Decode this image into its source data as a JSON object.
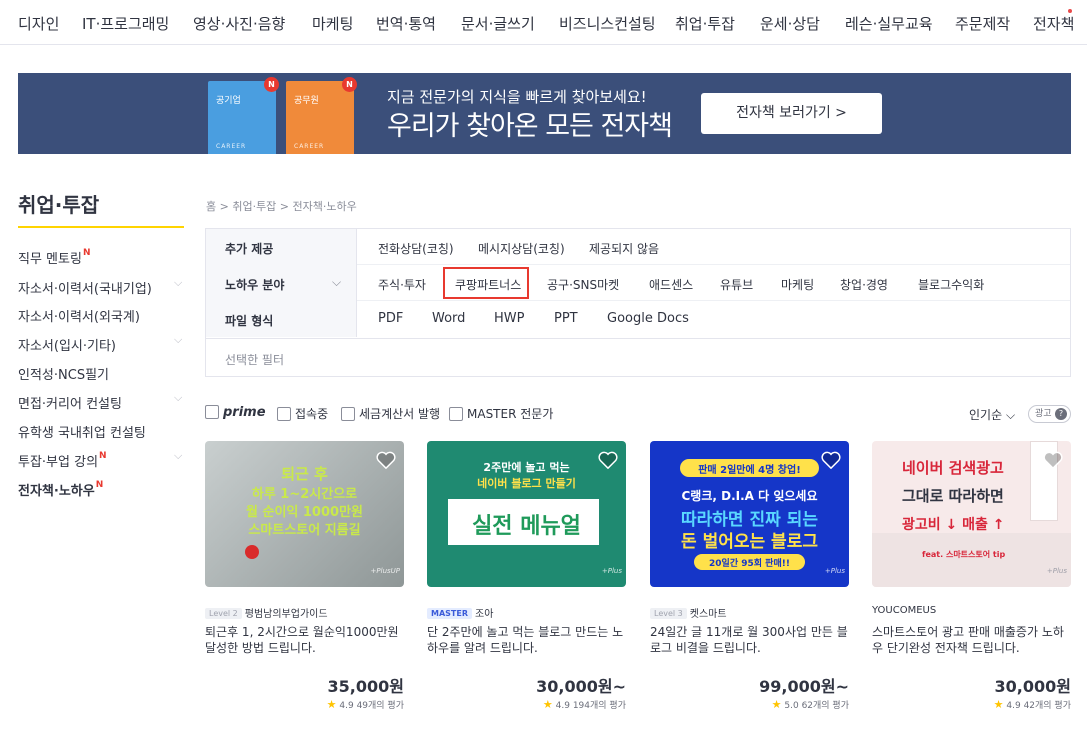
{
  "topnav": [
    "디자인",
    "IT·프로그래밍",
    "영상·사진·음향",
    "마케팅",
    "번역·통역",
    "문서·글쓰기",
    "비즈니스컨설팅",
    "취업·투잡",
    "운세·상담",
    "레슨·실무교육",
    "주문제작",
    "전자책"
  ],
  "banner": {
    "book1_title": "공기업",
    "book2_title": "공무원",
    "book_footer": "CAREER",
    "book_badge": "N",
    "sub": "지금 전문가의 지식을 빠르게 찾아보세요!",
    "main": "우리가 찾아온 모든 전자책",
    "button": "전자책 보러가기 >"
  },
  "sidebar": {
    "title": "취업·투잡",
    "items": [
      {
        "label": "직무 멘토링",
        "new": "N"
      },
      {
        "label": "자소서·이력서(국내기업)"
      },
      {
        "label": "자소서·이력서(외국계)"
      },
      {
        "label": "자소서(입시·기타)"
      },
      {
        "label": "인적성·NCS필기"
      },
      {
        "label": "면접·커리어 컨설팅"
      },
      {
        "label": "유학생 국내취업 컨설팅"
      },
      {
        "label": "투잡·부업 강의",
        "new": "N"
      },
      {
        "label": "전자책·노하우",
        "new": "N"
      }
    ]
  },
  "breadcrumb": "홈 > 취업·투잡 > 전자책·노하우",
  "filters": {
    "rows": [
      {
        "label": "추가 제공",
        "options": [
          "전화상담(코칭)",
          "메시지상담(코칭)",
          "제공되지 않음"
        ]
      },
      {
        "label": "노하우 분야",
        "options": [
          "주식·투자",
          "쿠팡파트너스",
          "공구·SNS마켓",
          "애드센스",
          "유튜브",
          "마케팅",
          "창업·경영",
          "블로그수익화"
        ]
      },
      {
        "label": "파일 형식",
        "options": [
          "PDF",
          "Word",
          "HWP",
          "PPT",
          "Google Docs"
        ]
      }
    ],
    "selected_placeholder": "선택한 필터"
  },
  "options": {
    "prime": "prime",
    "checks": [
      "접속중",
      "세금계산서 발행",
      "MASTER 전문가"
    ],
    "sort": "인기순",
    "ad": "광고"
  },
  "cards": [
    {
      "thumb": {
        "line1": "퇴근 후",
        "line2": "하루 1~2시간으로",
        "line3": "월 순이익 1000만원",
        "line4": "스마트스토어 지름길",
        "tag": "+PlusUP"
      },
      "level": "Level 2",
      "seller": "평범남의부업가이드",
      "title": "퇴근후 1, 2시간으로 월순익1000만원 달성한 방법 드립니다.",
      "price": "35,000원",
      "rating": "4.9",
      "reviews": "49개의 평가"
    },
    {
      "thumb": {
        "line1": "2주만에 놀고 먹는",
        "line2": "네이버 블로그 만들기",
        "line3": "실전 메뉴얼",
        "tag": "+Plus"
      },
      "level": "MASTER",
      "seller": "조아",
      "title": "단 2주만에 놀고 먹는 블로그 만드는 노하우를 알려 드립니다.",
      "price": "30,000원~",
      "rating": "4.9",
      "reviews": "194개의 평가"
    },
    {
      "thumb": {
        "line1": "판매 2일만에 4명 창업!",
        "line2": "C랭크, D.I.A 다 잊으세요",
        "line3": "따라하면 진짜 되는",
        "line4": "돈 벌어오는 블로그",
        "line5": "20일간 95회 판매!!",
        "tag": "+Plus"
      },
      "level": "Level 3",
      "seller": "켓스마트",
      "title": "24일간 글 11개로 월 300사업 만든 블로그 비결을 드립니다.",
      "price": "99,000원~",
      "rating": "5.0",
      "reviews": "62개의 평가"
    },
    {
      "thumb": {
        "line1": "네이버 검색광고",
        "line2": "그대로 따라하면",
        "line3": "광고비 ↓ 매출 ↑",
        "line4": "feat. 스마트스토어 tip",
        "tag": "+Plus"
      },
      "seller": "YOUCOMEUS",
      "title": "스마트스토어 광고 판매 매출증가 노하우 단기완성 전자책 드립니다.",
      "price": "30,000원",
      "rating": "4.9",
      "reviews": "42개의 평가"
    }
  ],
  "colors": {
    "accent_yellow": "#ffd400",
    "highlight_red": "#e8392f",
    "banner_bg": "#3b4f7a",
    "star": "#ffc400"
  }
}
